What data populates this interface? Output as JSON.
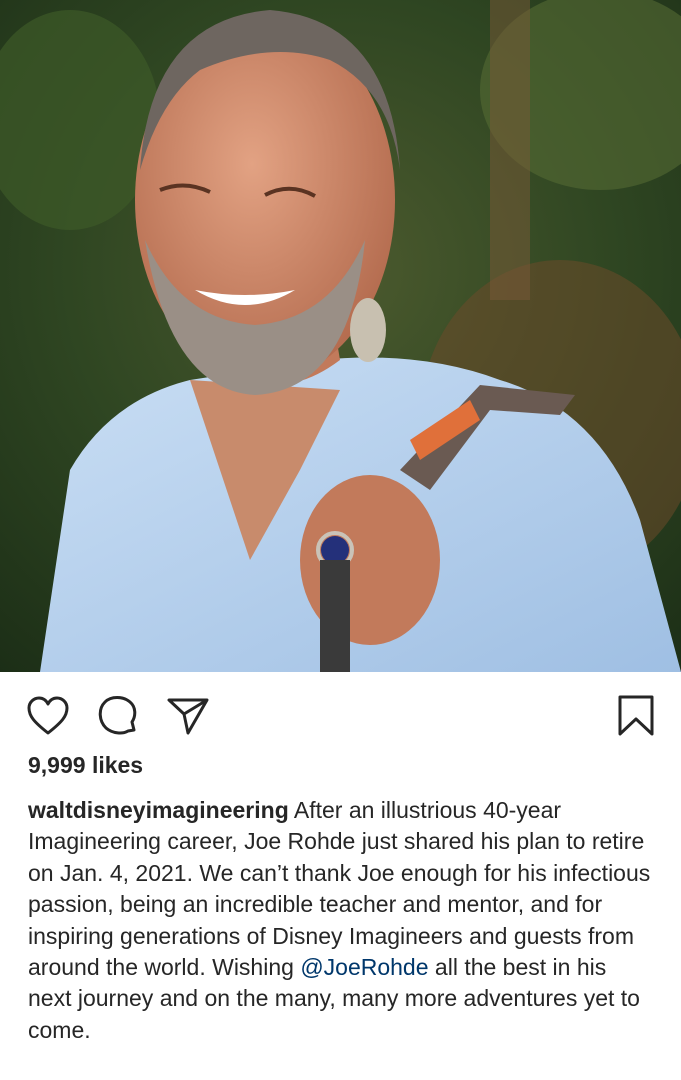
{
  "post": {
    "photo_alt": "",
    "likes": "9,999 likes",
    "username": "waltdisneyimagineering",
    "caption_before_mention": "After an illustrious 40-year Imagineering career, Joe Rohde just shared his plan to retire on Jan. 4, 2021. We can’t thank Joe enough for his infectious passion, being an incredible teacher and mentor, and for inspiring generations of Disney Imagineers and guests from around the world. Wishing ",
    "mention": "@JoeRohde",
    "caption_after_mention": " all the best in his next journey and on the many, many more adventures yet to come."
  },
  "actions": {
    "like_icon": "heart-icon",
    "comment_icon": "comment-bubble-icon",
    "share_icon": "paper-plane-icon",
    "save_icon": "bookmark-icon"
  },
  "colors": {
    "text": "#262626",
    "mention": "#00376b",
    "shirt": "#b9d3ef"
  }
}
